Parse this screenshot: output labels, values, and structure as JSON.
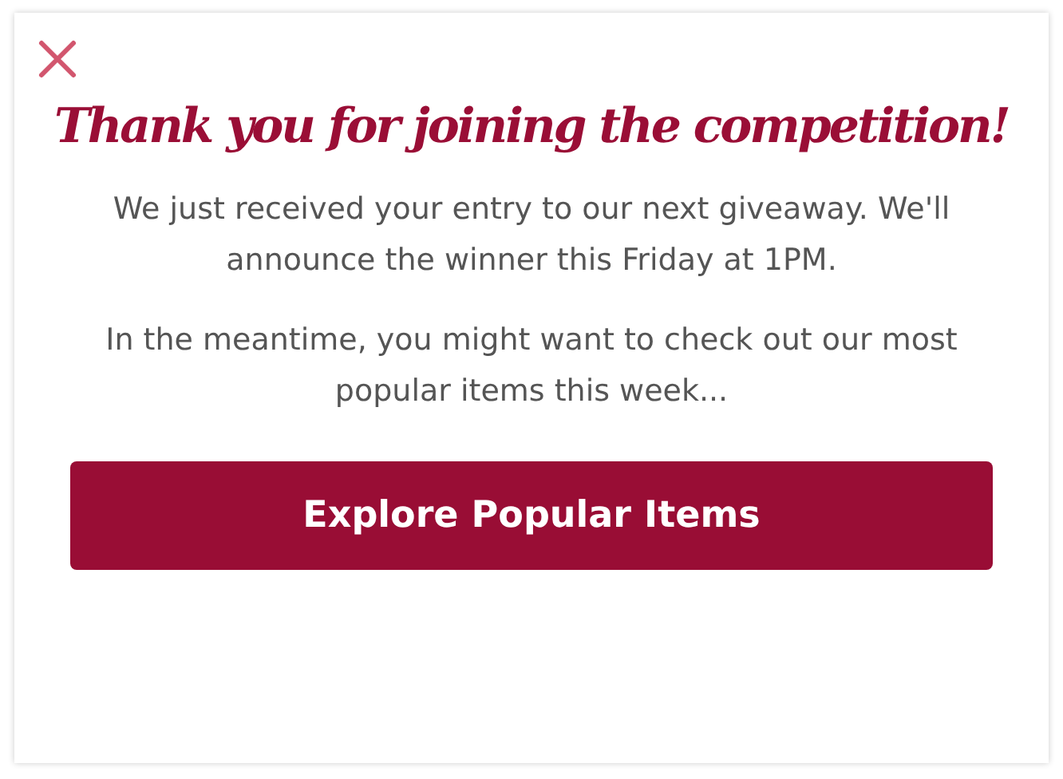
{
  "dialog": {
    "title": "Thank you for joining the competition!",
    "paragraphs": [
      "We just received your entry to our next giveaway. We'll announce the winner this Friday at 1PM.",
      "In the meantime, you might want to check out our most popular items this week..."
    ],
    "button": "Explore Popular Items"
  }
}
